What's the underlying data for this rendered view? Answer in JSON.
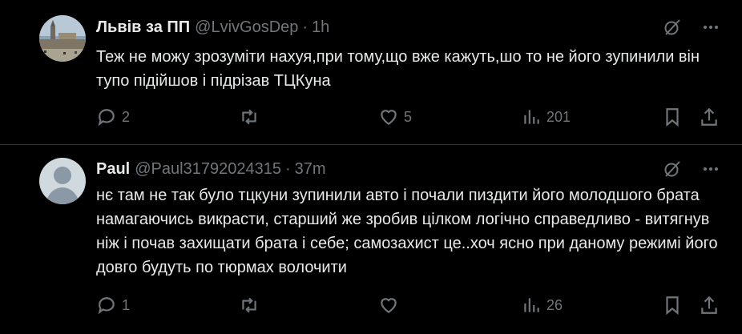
{
  "posts": [
    {
      "author": {
        "name": "Львів за ПП",
        "handle": "@LvivGosDep",
        "separator": "·",
        "time": "1h",
        "avatar": "city-photo-avatar"
      },
      "text": "Теж не можу зрозуміти нахуя,при тому,що вже кажуть,шо то не його зупинили він тупо підійшов і підрізав ТЦКуна",
      "stats": {
        "replies": "2",
        "reposts": "",
        "likes": "5",
        "views": "201"
      }
    },
    {
      "author": {
        "name": "Paul",
        "handle": "@Paul31792024315",
        "separator": "·",
        "time": "37m",
        "avatar": "default-avatar"
      },
      "text": "нє там не так було тцкуни зупинили авто і почали пиздити його молодшого брата намагаючись викрасти, старший же зробив цілком логічно справедливо - витягнув ніж і почав захищати брата і себе; самозахист це..хоч ясно при даному режимі його довго будуть по тюрмах волочити",
      "stats": {
        "replies": "1",
        "reposts": "",
        "likes": "",
        "views": "26"
      }
    }
  ],
  "icons": {
    "grok": "grok-icon",
    "more": "more-icon",
    "reply": "reply-icon",
    "repost": "repost-icon",
    "like": "heart-icon",
    "views": "views-icon",
    "bookmark": "bookmark-icon",
    "share": "share-icon"
  },
  "colors": {
    "background": "#000000",
    "text": "#e7e9ea",
    "muted": "#71767b",
    "divider": "#2f3336"
  }
}
